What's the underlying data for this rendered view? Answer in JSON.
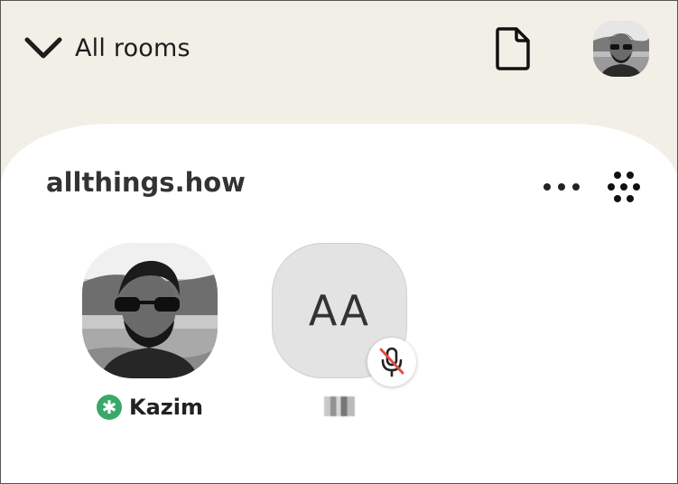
{
  "header": {
    "rooms_label": "All rooms",
    "chevron_icon": "chevron-down-icon",
    "document_icon": "document-icon"
  },
  "room": {
    "name": "allthings.how",
    "more_icon": "more-horizontal-icon",
    "grid_icon": "dots-grid-icon"
  },
  "members": [
    {
      "name": "Kazim",
      "badge_icon": "moderator-asterisk-icon",
      "badge_color": "#3aa868"
    },
    {
      "initials": "AA",
      "status_icon": "mic-muted-icon",
      "mute_color": "#e04a3f"
    }
  ]
}
